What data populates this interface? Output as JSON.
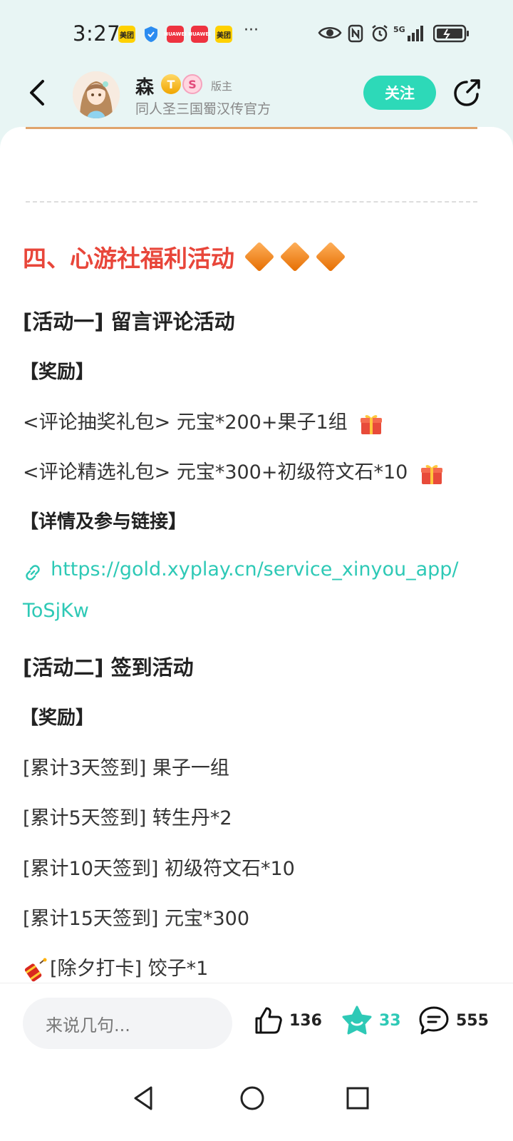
{
  "status_bar": {
    "time": "3:27",
    "badges": [
      "美团",
      "HUAWEI",
      "HUAWEI",
      "美团"
    ],
    "more": "···",
    "network": "5G"
  },
  "header": {
    "author_name": "森",
    "level_badge": "T",
    "medal_badge": "S",
    "role": "版主",
    "description": "同人圣三国蜀汉传官方",
    "follow_label": "关注"
  },
  "post": {
    "section_title": "四、心游社福利活动",
    "activity1": {
      "title": "[活动一] 留言评论活动",
      "reward_heading": "【奖励】",
      "reward1": "<评论抽奖礼包> 元宝*200+果子1组",
      "reward2": "<评论精选礼包> 元宝*300+初级符文石*10",
      "details_heading": "【详情及参与链接】",
      "link_line1": "https://gold.xyplay.cn/service_xinyou_app/",
      "link_line2": "ToSjKw"
    },
    "activity2": {
      "title": "[活动二] 签到活动",
      "reward_heading": "【奖励】",
      "rewards": [
        "[累计3天签到] 果子一组",
        "[累计5天签到] 转生丹*2",
        "[累计10天签到] 初级符文石*10",
        "[累计15天签到] 元宝*300",
        "[除夕打卡] 饺子*1"
      ]
    }
  },
  "bottom_bar": {
    "comment_placeholder": "来说几句...",
    "like_count": "136",
    "favorite_count": "33",
    "comment_count": "555"
  },
  "colors": {
    "accent": "#2dd9b8",
    "section_title": "#e8463a",
    "link": "#2ec9b6"
  }
}
